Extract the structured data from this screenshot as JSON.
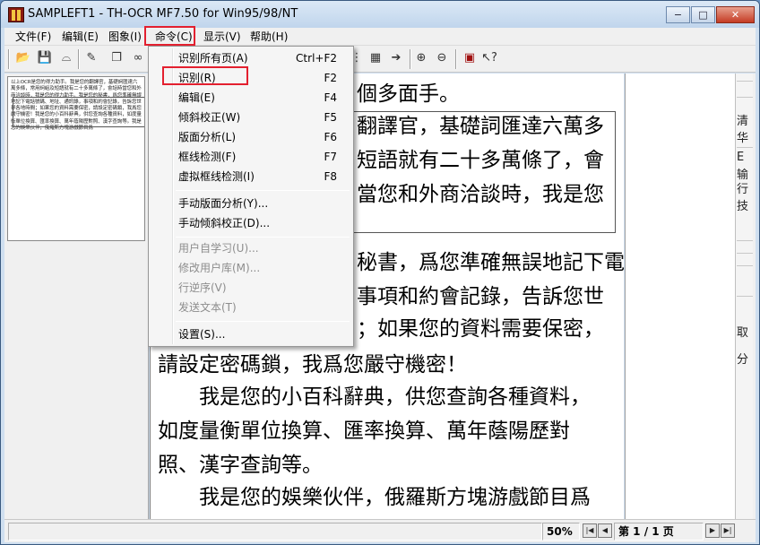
{
  "window": {
    "title": "SAMPLEFT1 - TH-OCR MF7.50 for Win95/98/NT",
    "minimize": "−",
    "maximize": "□",
    "close": "✕"
  },
  "menubar": [
    "文件(F)",
    "编辑(E)",
    "图象(I)",
    "命令(C)",
    "显示(V)",
    "帮助(H)"
  ],
  "toolbar_icons": [
    "open-folder-icon",
    "save-icon",
    "scanner-icon",
    "pen-icon",
    "copy-icon",
    "glasses-icon",
    "grid-icon",
    "table-icon",
    "arrow-icon",
    "zoom-in-icon",
    "zoom-out-icon",
    "book-icon",
    "help-pointer-icon"
  ],
  "command_menu": [
    {
      "label": "识别所有页(A)",
      "key": "Ctrl+F2",
      "enabled": true
    },
    {
      "label": "识别(R)",
      "key": "F2",
      "enabled": true
    },
    {
      "label": "编辑(E)",
      "key": "F4",
      "enabled": true
    },
    {
      "label": "倾斜校正(W)",
      "key": "F5",
      "enabled": true
    },
    {
      "label": "版面分析(L)",
      "key": "F6",
      "enabled": true
    },
    {
      "label": "框线检测(F)",
      "key": "F7",
      "enabled": true
    },
    {
      "label": "虚拟框线检测(I)",
      "key": "F8",
      "enabled": true
    },
    {
      "label": "手动版面分析(Y)...",
      "key": "",
      "enabled": true
    },
    {
      "label": "手动倾斜校正(D)...",
      "key": "",
      "enabled": true
    },
    {
      "label": "用户自学习(U)...",
      "key": "",
      "enabled": false
    },
    {
      "label": "修改用户库(M)...",
      "key": "",
      "enabled": false
    },
    {
      "label": "行逆序(V)",
      "key": "",
      "enabled": false
    },
    {
      "label": "发送文本(T)",
      "key": "",
      "enabled": false
    },
    {
      "label": "设置(S)...",
      "key": "",
      "enabled": true
    }
  ],
  "thumbnail_text": "以上OCR是您的得力助手。我是您的翻譯官，基礎詞匯達六萬多條，常用詞組及短語就有二十多萬條了，會話時當您和外商洽談時，我是您的得力助手。我是您的秘書，爲您準確無誤地記下電話號碼、地址、通訊錄，事項和約會記錄，告訴您世界各地時間；如果您的資料需要保密，請設定密碼鎖，我爲您嚴守機密！我是您的小百科辭典，供您查詢各種資料，如度量衡單位換算、匯率換算、萬年蔭陽歷對照、漢字查詢等。我是您的娛樂伙伴，俄羅斯方塊游戲節目爲",
  "document_lines": [
    "個多面手。",
    "翻譯官，基礎詞匯達六萬多",
    "短語就有二十多萬條了，會",
    "當您和外商洽談時，我是您",
    "秘書，爲您準確無誤地記下電",
    "事項和約會記錄，告訴您世",
    "；如果您的資料需要保密，",
    "請設定密碼鎖，我爲您嚴守機密！",
    "　　我是您的小百科辭典，供您查詢各種資料，",
    "如度量衡單位換算、匯率換算、萬年蔭陽歷對",
    "照、漢字查詢等。",
    "　　我是您的娛樂伙伴，俄羅斯方塊游戲節目爲"
  ],
  "right_fragments": [
    "清华",
    "E",
    "输",
    "行技",
    "取",
    "分"
  ],
  "status": {
    "zoom": "50%",
    "page": "第 1 / 1 页",
    "first": "|◀",
    "prev": "◀",
    "next": "▶",
    "last": "▶|"
  },
  "colors": {
    "highlight": "#e3202f",
    "menu_bg": "#f5f5f5"
  }
}
